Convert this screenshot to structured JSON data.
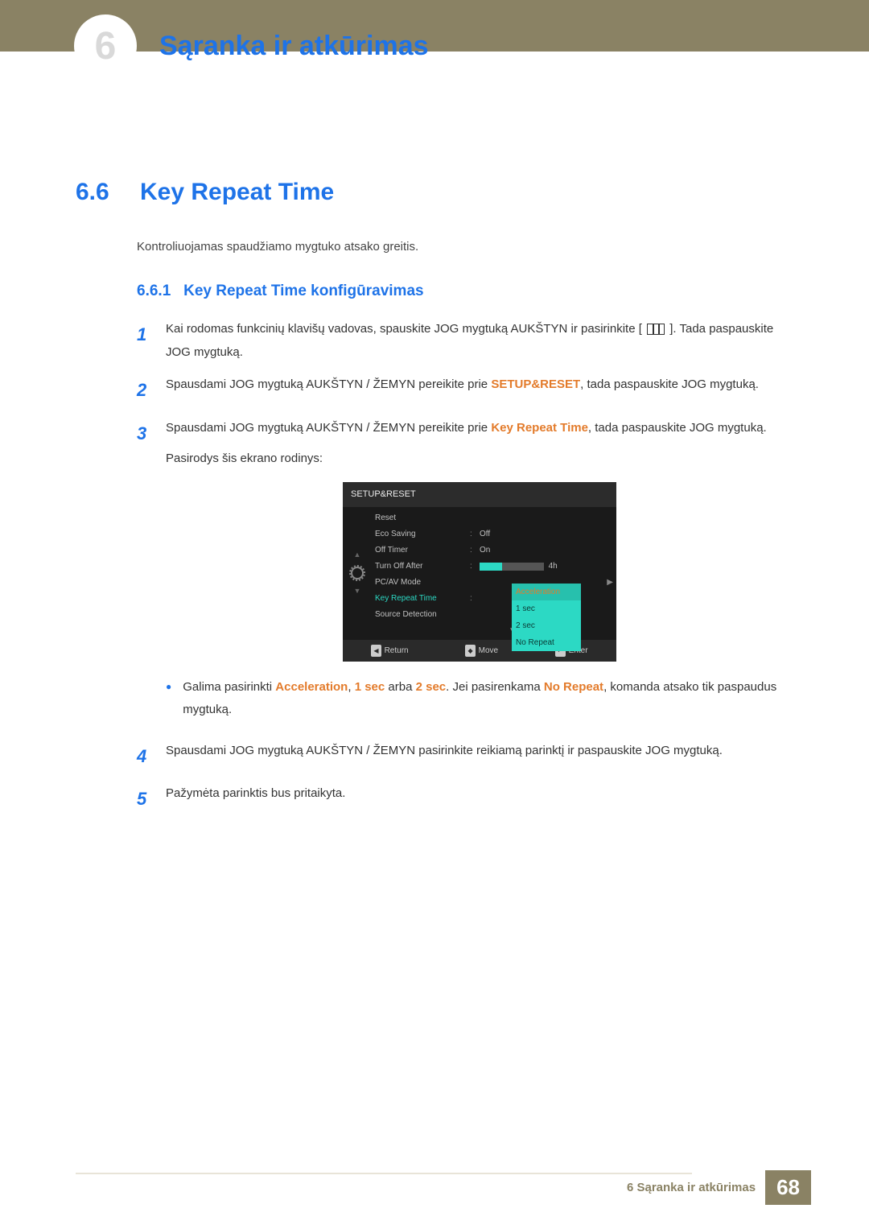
{
  "chapter": {
    "number": "6",
    "title": "Sąranka ir atkūrimas"
  },
  "section": {
    "number": "6.6",
    "title": "Key Repeat Time",
    "intro": "Kontroliuojamas spaudžiamo mygtuko atsako greitis."
  },
  "subsection": {
    "number": "6.6.1",
    "title": "Key Repeat Time konfigūravimas"
  },
  "steps": {
    "s1a": "Kai rodomas funkcinių klavišų vadovas, spauskite JOG mygtuką AUKŠTYN ir pasirinkite [",
    "s1b": "]. Tada paspauskite JOG mygtuką.",
    "s2a": "Spausdami JOG mygtuką AUKŠTYN / ŽEMYN pereikite prie ",
    "s2hl": "SETUP&RESET",
    "s2b": ", tada paspauskite JOG mygtuką.",
    "s3a": "Spausdami JOG mygtuką AUKŠTYN / ŽEMYN pereikite prie ",
    "s3hl": "Key Repeat Time",
    "s3b": ", tada paspauskite JOG mygtuką.",
    "s3c": "Pasirodys šis ekrano rodinys:",
    "bulleta": "Galima pasirinkti ",
    "bhl1": "Acceleration",
    "bsep1": ", ",
    "bhl2": "1 sec",
    "bsep2": " arba ",
    "bhl3": "2 sec",
    "bsep3": ". Jei pasirenkama ",
    "bhl4": "No Repeat",
    "bulletb": ", komanda atsako tik paspaudus mygtuką.",
    "s4": "Spausdami JOG mygtuką AUKŠTYN / ŽEMYN pasirinkite reikiamą parinktį ir paspauskite JOG mygtuką.",
    "s5": "Pažymėta parinktis bus pritaikyta."
  },
  "osd": {
    "title": "SETUP&RESET",
    "rows": {
      "reset": "Reset",
      "eco": "Eco Saving",
      "eco_v": "Off",
      "timer": "Off Timer",
      "timer_v": "On",
      "turnoff": "Turn Off After",
      "turnoff_v": "4h",
      "pcav": "PC/AV Mode",
      "krt": "Key Repeat Time",
      "src": "Source Detection"
    },
    "popup": {
      "p1": "Acceleration",
      "p2": "1 sec",
      "p3": "2 sec",
      "p4": "No Repeat"
    },
    "footer": {
      "ret": "Return",
      "mov": "Move",
      "ent": "Enter"
    }
  },
  "footer": {
    "text": "6 Sąranka ir atkūrimas",
    "page": "68"
  }
}
